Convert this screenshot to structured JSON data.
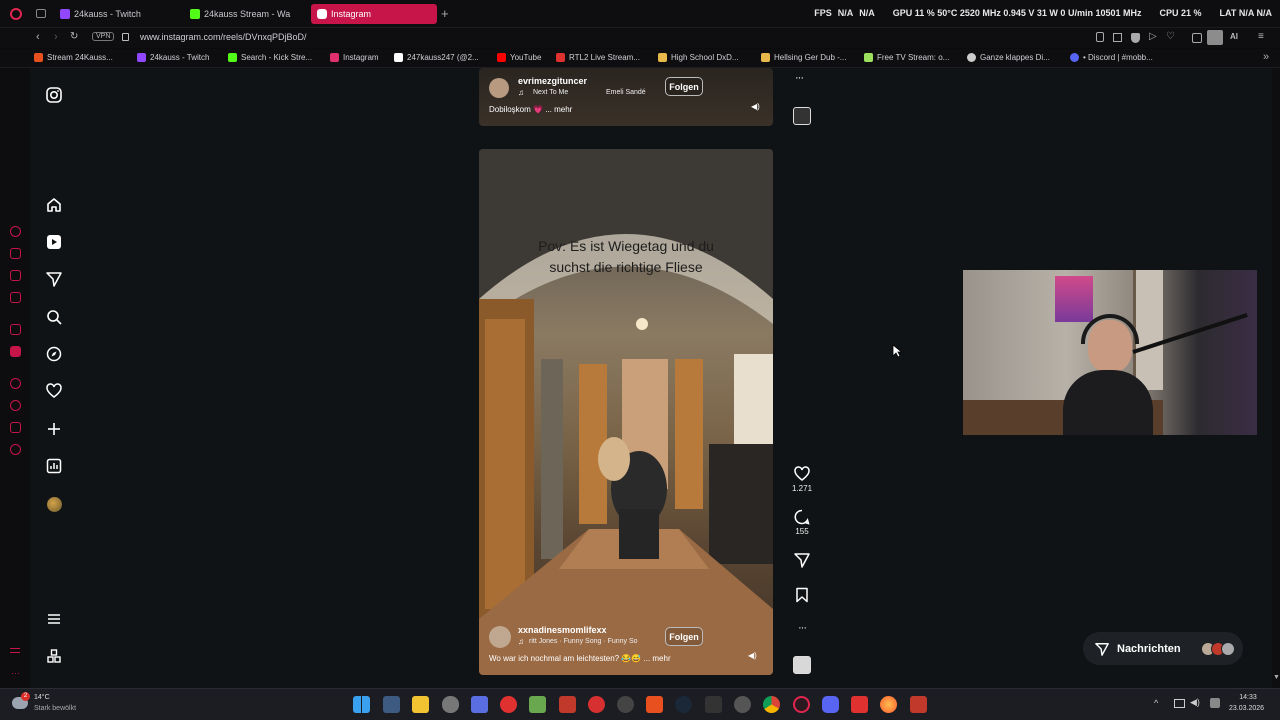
{
  "tabs": [
    {
      "label": "24kauss - Twitch",
      "icon": "twitch-icon",
      "color": "#9146ff"
    },
    {
      "label": "24kauss Stream - Wa",
      "icon": "kick-icon",
      "color": "#53fc18"
    },
    {
      "label": "Instagram",
      "icon": "instagram-icon",
      "color": "#e1306c",
      "active": true
    }
  ],
  "stats": {
    "fps_label": "FPS",
    "fps_value": "N/A",
    "fps_value2": "N/A",
    "gpu": "GPU 11 % 50°C 2520 MHz 0.945 V 31 W 0 U/min 10501 MHz",
    "cpu": "CPU 21 %",
    "lat": "LAT N/A N/A"
  },
  "address": {
    "url": "www.instagram.com/reels/DVnxqPDjBoD/",
    "vpn_label": "VPN"
  },
  "bookmarks": [
    {
      "label": "Stream 24Kauss...",
      "color": "#e8501f"
    },
    {
      "label": "24kauss - Twitch",
      "color": "#9146ff"
    },
    {
      "label": "Search - Kick Stre...",
      "color": "#53fc18"
    },
    {
      "label": "Instagram",
      "color": "#e1306c"
    },
    {
      "label": "247kauss247 (@2...",
      "color": "#ffffff"
    },
    {
      "label": "YouTube",
      "color": "#ff0000"
    },
    {
      "label": "RTL2 Live Stream...",
      "color": "#e03131"
    },
    {
      "label": "High School DxD...",
      "color": "#e8b84a"
    },
    {
      "label": "Hellsing Ger Dub -...",
      "color": "#e8b84a"
    },
    {
      "label": "Free TV Stream: o...",
      "color": "#9be15d"
    },
    {
      "label": "Ganze klappes Di...",
      "color": "#cccccc"
    },
    {
      "label": "• Discord | #mobb...",
      "color": "#5865f2"
    }
  ],
  "reel_top": {
    "username": "evrimezgituncer",
    "song": "Next To Me",
    "artist": "Emeli Sandé",
    "caption": "Dobiloşkom 💗 ... mehr",
    "follow_label": "Folgen"
  },
  "reel_main": {
    "overlay_text": "Pov: Es ist Wiegetag und du suchst die richtige Fliese",
    "username": "xxnadinesmomlifexx",
    "song": "ritt Jones · Funny Song · Funny So",
    "caption": "Wo war ich nochmal am leichtesten? 😂😅 ... mehr",
    "follow_label": "Folgen",
    "likes": "1.271",
    "comments": "155"
  },
  "messages": {
    "label": "Nachrichten"
  },
  "weather": {
    "temp": "14°C",
    "desc": "Stark bewölkt"
  },
  "clock": {
    "time": "14:33",
    "date": "23.03.2026"
  },
  "notification_badge": "2"
}
